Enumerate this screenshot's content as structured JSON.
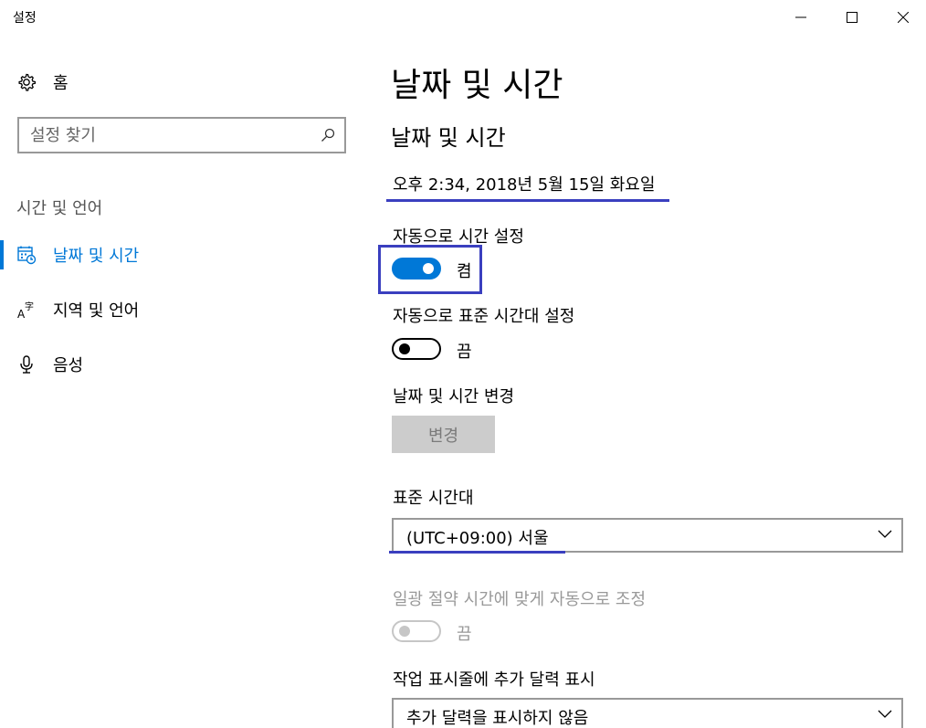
{
  "window": {
    "title": "설정"
  },
  "sidebar": {
    "home_label": "홈",
    "search_placeholder": "설정 찾기",
    "section_heading": "시간 및 언어",
    "items": [
      {
        "label": "날짜 및 시간",
        "icon": "calendar-clock-icon",
        "active": true
      },
      {
        "label": "지역 및 언어",
        "icon": "region-language-icon",
        "active": false
      },
      {
        "label": "음성",
        "icon": "microphone-icon",
        "active": false
      }
    ]
  },
  "main": {
    "page_title": "날짜 및 시간",
    "subsection_title": "날짜 및 시간",
    "current_datetime": "오후 2:34, 2018년 5월 15일 화요일",
    "auto_time": {
      "label": "자동으로 시간 설정",
      "state": "켬",
      "on": true
    },
    "auto_timezone": {
      "label": "자동으로 표준 시간대 설정",
      "state": "끔",
      "on": false
    },
    "change_datetime": {
      "label": "날짜 및 시간 변경",
      "button": "변경"
    },
    "timezone": {
      "label": "표준 시간대",
      "value": "(UTC+09:00) 서울"
    },
    "dst": {
      "label": "일광 절약 시간에 맞게 자동으로 조정",
      "state": "끔",
      "on": false,
      "enabled": false
    },
    "extra_calendar": {
      "label": "작업 표시줄에 추가 달력 표시",
      "value": "추가 달력을 표시하지 않음"
    }
  },
  "colors": {
    "accent": "#0078d7",
    "annotation": "#3a3fbf"
  }
}
